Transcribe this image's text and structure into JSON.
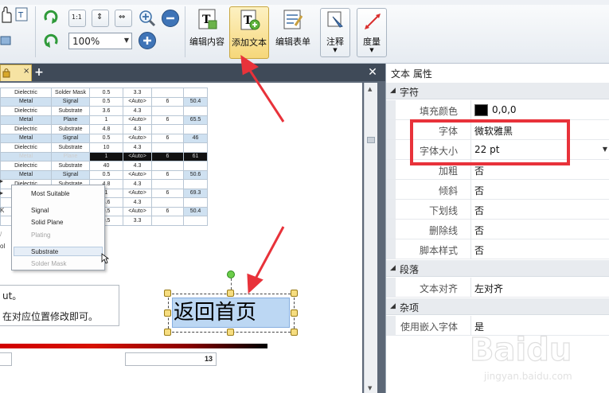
{
  "toolbar": {
    "zoom_value": "100%",
    "buttons": [
      {
        "label": "编辑内容",
        "icon": "edit-content-icon"
      },
      {
        "label": "添加文本",
        "icon": "add-text-icon"
      },
      {
        "label": "编辑表单",
        "icon": "edit-form-icon"
      },
      {
        "label": "注释",
        "icon": "annotate-icon"
      },
      {
        "label": "度量",
        "icon": "measure-icon"
      }
    ]
  },
  "canvas": {
    "stack_rows": [
      [
        "Dielectric",
        "Solder Mask",
        "0.5",
        "3.3",
        "",
        ""
      ],
      [
        "Metal",
        "Signal",
        "0.5",
        "<Auto>",
        "6",
        "50.4"
      ],
      [
        "Dielectric",
        "Substrate",
        "3.6",
        "4.3",
        "",
        ""
      ],
      [
        "Metal",
        "Plane",
        "1",
        "<Auto>",
        "6",
        "65.5"
      ],
      [
        "Dielectric",
        "Substrate",
        "4.8",
        "4.3",
        "",
        ""
      ],
      [
        "Metal",
        "Signal",
        "0.5",
        "<Auto>",
        "6",
        "46"
      ],
      [
        "Dielectric",
        "Substrate",
        "10",
        "4.3",
        "",
        ""
      ],
      [
        "Metal",
        "Plane",
        "1",
        "<Auto>",
        "6",
        "61"
      ],
      [
        "Dielectric",
        "Substrate",
        "40",
        "4.3",
        "",
        ""
      ],
      [
        "Metal",
        "Signal",
        "0.5",
        "<Auto>",
        "6",
        "50.6"
      ],
      [
        "Dielectric",
        "Substrate",
        "4.8",
        "4.3",
        "",
        ""
      ],
      [
        "",
        "",
        "1",
        "<Auto>",
        "6",
        "69.3"
      ],
      [
        "",
        "",
        "3.6",
        "4.3",
        "",
        ""
      ],
      [
        "",
        "",
        "0.5",
        "<Auto>",
        "6",
        "50.4"
      ],
      [
        "",
        "",
        "0.5",
        "3.3",
        "",
        ""
      ]
    ],
    "context_menu": {
      "items": [
        {
          "label": "Most Suitable",
          "disabled": false
        },
        {
          "label": "Signal",
          "disabled": false
        },
        {
          "label": "Solid Plane",
          "disabled": false
        },
        {
          "label": "Plating",
          "disabled": true
        },
        {
          "label": "Substrate",
          "disabled": false
        },
        {
          "label": "Solder Mask",
          "disabled": true
        }
      ]
    },
    "left_glyphs": [
      "K",
      "/",
      "ol"
    ],
    "note_line1": "ut。",
    "note_line2": "在对应位置修改即可。",
    "selected_text": "返回首页",
    "field_value": "13"
  },
  "panel": {
    "title": "文本 属性",
    "sections": {
      "char": "字符",
      "para": "段落",
      "misc": "杂项"
    },
    "props": {
      "fill_color": {
        "label": "填充颜色",
        "value": "0,0,0",
        "color": "#000000"
      },
      "font": {
        "label": "字体",
        "value": "微软雅黑"
      },
      "font_size": {
        "label": "字体大小",
        "value": "22 pt"
      },
      "bold": {
        "label": "加粗",
        "value": "否"
      },
      "italic": {
        "label": "倾斜",
        "value": "否"
      },
      "underline": {
        "label": "下划线",
        "value": "否"
      },
      "strike": {
        "label": "删除线",
        "value": "否"
      },
      "script": {
        "label": "脚本样式",
        "value": "否"
      },
      "align": {
        "label": "文本对齐",
        "value": "左对齐"
      },
      "embed": {
        "label": "使用嵌入字体",
        "value": "是"
      }
    }
  },
  "watermark": {
    "brand": "Baidu",
    "site": "jingyan.baidu.com"
  },
  "colors": {
    "accent_red": "#e8323a",
    "selection_blue": "#bcd7f3",
    "tab_gold": "#f6e3a3"
  }
}
